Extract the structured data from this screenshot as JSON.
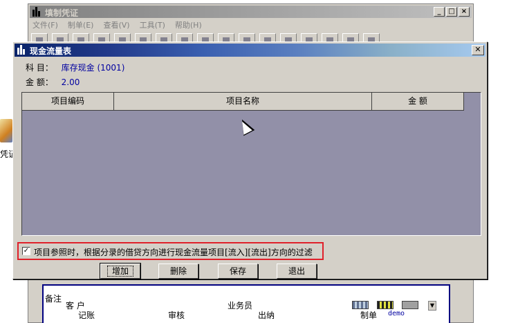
{
  "background_window": {
    "title": "填制凭证",
    "menu": [
      "文件(F)",
      "制单(E)",
      "查看(V)",
      "工具(T)",
      "帮助(H)"
    ],
    "bottom": {
      "remark_label": "备注",
      "customer_label": "客 户",
      "salesperson_label": "业务员",
      "status": {
        "bookkeeping": "记账",
        "review": "审核",
        "cashier": "出纳",
        "maker_label": "制单",
        "maker_value": "demo"
      }
    }
  },
  "desktop": {
    "icon_label": "凭证"
  },
  "dialog": {
    "title": "现金流量表",
    "subject_label": "科 目：",
    "subject_value": "库存现金 (1001)",
    "amount_label": "金 额：",
    "amount_value": "2.00",
    "columns": [
      "项目编码",
      "项目名称",
      "金 额"
    ],
    "rows": [],
    "filter": {
      "checked": true,
      "label": "项目参照时，根据分录的借贷方向进行现金流量项目[流入][流出]方向的过滤"
    },
    "buttons": {
      "add": "增加",
      "delete": "删除",
      "save": "保存",
      "exit": "退出"
    }
  },
  "colors": {
    "title_active_start": "#0a246a",
    "title_active_end": "#a6caf0",
    "grid_background": "#9290a8",
    "highlight_border": "#e0202a",
    "value_text": "#0000a0"
  }
}
